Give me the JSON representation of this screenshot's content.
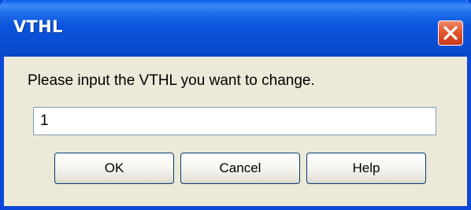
{
  "window": {
    "title": "VTHL",
    "close_icon": "close-x-icon"
  },
  "dialog": {
    "prompt": "Please input the VTHL you want to change.",
    "input_value": "1"
  },
  "buttons": {
    "ok_label": "OK",
    "cancel_label": "Cancel",
    "help_label": "Help"
  },
  "colors": {
    "titlebar": "#0a4fd6",
    "close_button": "#e2572e",
    "dialog_background": "#ece9d8",
    "button_border": "#003c74"
  }
}
